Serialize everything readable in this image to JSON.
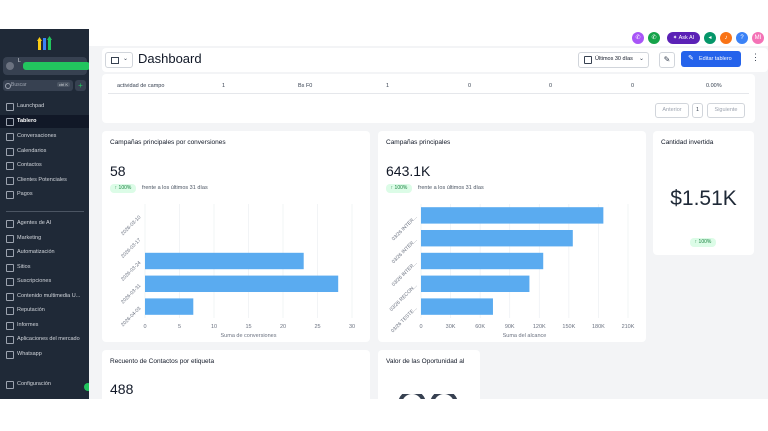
{
  "sidebar": {
    "account_line": "L",
    "search_placeholder": "Buscar",
    "search_shortcut": "ctrl K",
    "items": [
      {
        "label": "Launchpad",
        "name": "sidebar-item-launchpad"
      },
      {
        "label": "Tablero",
        "name": "sidebar-item-tablero",
        "active": true
      },
      {
        "label": "Conversaciones",
        "name": "sidebar-item-conversaciones"
      },
      {
        "label": "Calendarios",
        "name": "sidebar-item-calendarios"
      },
      {
        "label": "Contactos",
        "name": "sidebar-item-contactos"
      },
      {
        "label": "Clientes Potenciales",
        "name": "sidebar-item-clientes-potenciales"
      },
      {
        "label": "Pagos",
        "name": "sidebar-item-pagos"
      },
      {
        "label": "Agentes de AI",
        "name": "sidebar-item-agentes-de-ai"
      },
      {
        "label": "Marketing",
        "name": "sidebar-item-marketing"
      },
      {
        "label": "Automatización",
        "name": "sidebar-item-automatizacion"
      },
      {
        "label": "Sitios",
        "name": "sidebar-item-sitios"
      },
      {
        "label": "Suscripciones",
        "name": "sidebar-item-suscripciones"
      },
      {
        "label": "Contenido multimedia U...",
        "name": "sidebar-item-contenido-multimedia"
      },
      {
        "label": "Reputación",
        "name": "sidebar-item-reputacion"
      },
      {
        "label": "Informes",
        "name": "sidebar-item-informes"
      },
      {
        "label": "Aplicaciones del mercado",
        "name": "sidebar-item-aplicaciones-del-mercado"
      },
      {
        "label": "Whatsapp",
        "name": "sidebar-item-whatsapp"
      },
      {
        "label": "Configuración",
        "name": "sidebar-item-configuracion"
      }
    ]
  },
  "topbar": {
    "ask_ai_label": "Ask AI",
    "avatar_initials": "MI",
    "colors": {
      "phone_purple": "#a855f7",
      "phone_green": "#16a34a",
      "megaphone": "#059669",
      "bell": "#f97316",
      "help": "#3b82f6",
      "avatar": "#f472b6",
      "ask_ai": "#5b21b6"
    }
  },
  "header": {
    "title": "Dashboard",
    "date_range": "Últimos 30 días",
    "edit_label": "Editar tablero"
  },
  "table": {
    "row": [
      "actividad de campo",
      "1",
      "Bs F0",
      "1",
      "0",
      "0",
      "0",
      "0.00%"
    ],
    "prev_label": "Anterior",
    "page": "1",
    "next_label": "Siguiente"
  },
  "cards": {
    "conversions": {
      "title": "Campañas principales por conversiones",
      "value": "58",
      "change": "↑ 100%",
      "compare": "frente a los últimos 31 días"
    },
    "main_campaigns": {
      "title": "Campañas principales",
      "value": "643.1K",
      "change": "↑ 100%",
      "compare": "frente a los últimos 31 días"
    },
    "invested": {
      "title": "Cantidad invertida",
      "value": "$1.51K",
      "change": "↑ 100%"
    },
    "contacts_by_tag": {
      "title": "Recuento de Contactos por etiqueta",
      "value": "488"
    },
    "opportunity_value": {
      "title": "Valor de las Oportunidad al"
    }
  },
  "chart_data": [
    {
      "type": "bar",
      "orientation": "horizontal",
      "categories": [
        "2026-03-10",
        "2026-03-17",
        "2026-03-24",
        "2026-03-31",
        "2026-04-03"
      ],
      "values": [
        0,
        0,
        23,
        28,
        7
      ],
      "xlabel": "Suma de conversiones",
      "xlim": [
        0,
        30
      ],
      "xticks": [
        "0",
        "5",
        "10",
        "15",
        "20",
        "25",
        "30"
      ],
      "color": "#5aabf0",
      "grid": true
    },
    {
      "type": "bar",
      "orientation": "horizontal",
      "categories": [
        "03/26 INTER...",
        "03/26 INTER...",
        "03/26 INTER...",
        "03/26 RECON...",
        "03/26 TESTE..."
      ],
      "values": [
        185000,
        154000,
        124000,
        110000,
        73000
      ],
      "xlabel": "Suma del alcance",
      "xlim": [
        0,
        210000
      ],
      "xticks": [
        "0",
        "30K",
        "60K",
        "90K",
        "120K",
        "150K",
        "180K",
        "210K"
      ],
      "color": "#5aabf0",
      "grid": true
    }
  ]
}
